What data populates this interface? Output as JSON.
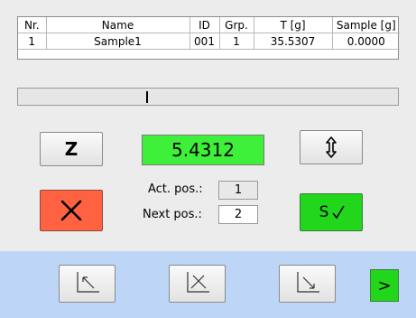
{
  "table": {
    "headers": [
      "Nr.",
      "Name",
      "ID",
      "Grp.",
      "T [g]",
      "Sample [g]"
    ],
    "rows": [
      [
        "1",
        "Sample1",
        "001",
        "1",
        "35.5307",
        "0.0000"
      ]
    ]
  },
  "progress": {
    "value_fraction": 0.34
  },
  "buttons": {
    "z_label": "Z",
    "save_label": "S",
    "next_label": ">"
  },
  "weight_display": "5.4312",
  "position": {
    "act_label": "Act. pos.:",
    "act_value": "1",
    "next_label": "Next pos.:",
    "next_value": "2"
  },
  "colors": {
    "weight_bg": "#3ef03a",
    "cancel_bg": "#ff6241",
    "save_bg": "#22d71b",
    "footer_bg": "#bdd6f7",
    "window_bg": "#ececec"
  },
  "icons": {
    "updown": "up-down-arrow-icon",
    "cancel": "x-icon",
    "save": "checkmark-icon",
    "footer_1": "arrow-up-left-icon",
    "footer_2": "crossed-arrow-icon",
    "footer_3": "arrow-down-right-icon"
  }
}
